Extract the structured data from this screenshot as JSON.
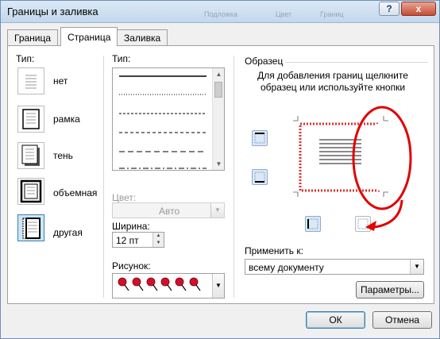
{
  "window": {
    "title": "Границы и заливка",
    "help_label": "?",
    "close_label": "x",
    "background_ghost": [
      "Подложка",
      "Цвет",
      "Границ"
    ]
  },
  "tabs": [
    {
      "label": "Граница",
      "active": false
    },
    {
      "label": "Страница",
      "active": true
    },
    {
      "label": "Заливка",
      "active": false
    }
  ],
  "type_section": {
    "label": "Тип:",
    "presets": [
      {
        "label": "нет",
        "icon": "preset-none-icon"
      },
      {
        "label": "рамка",
        "icon": "preset-box-icon"
      },
      {
        "label": "тень",
        "icon": "preset-shadow-icon"
      },
      {
        "label": "объемная",
        "icon": "preset-3d-icon"
      },
      {
        "label": "другая",
        "icon": "preset-custom-icon",
        "selected": true
      }
    ]
  },
  "style_section": {
    "label": "Тип:",
    "line_styles": [
      "solid",
      "dotted",
      "dashed",
      "dash-small",
      "dash-large",
      "dash-dot"
    ],
    "color_label": "Цвет:",
    "color_value": "Авто",
    "width_label": "Ширина:",
    "width_value": "12 пт",
    "art_label": "Рисунок:"
  },
  "preview_section": {
    "label": "Образец",
    "hint": "Для добавления границ щелкните образец или используйте кнопки",
    "apply_label": "Применить к:",
    "apply_value": "всему документу",
    "options_button": "Параметры..."
  },
  "footer": {
    "ok": "ОК",
    "cancel": "Отмена"
  },
  "colors": {
    "accent": "#3c7fb1",
    "annotation": "#e00000",
    "art_pin": "#d0102a"
  }
}
